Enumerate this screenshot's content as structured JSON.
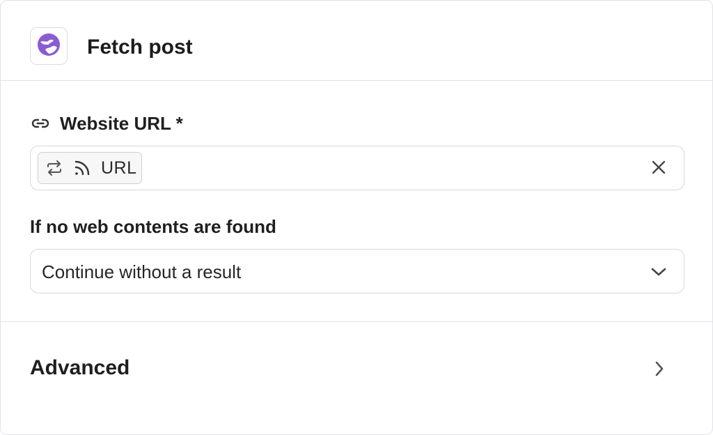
{
  "header": {
    "title": "Fetch post",
    "icon": "globe-icon",
    "icon_color": "#8a5cd1"
  },
  "url_field": {
    "label": "Website URL *",
    "label_icon": "link-icon",
    "chip": {
      "icons": [
        "repeat-icon",
        "rss-icon"
      ],
      "text": "URL"
    },
    "clear_icon": "close-icon"
  },
  "no_content_field": {
    "label": "If no web contents are found",
    "selected": "Continue without a result",
    "chevron_icon": "chevron-down-icon"
  },
  "advanced": {
    "label": "Advanced",
    "chevron_icon": "chevron-right-icon"
  },
  "colors": {
    "border": "#e2e2e6",
    "accent": "#8a5cd1",
    "text": "#1f1f1f"
  }
}
